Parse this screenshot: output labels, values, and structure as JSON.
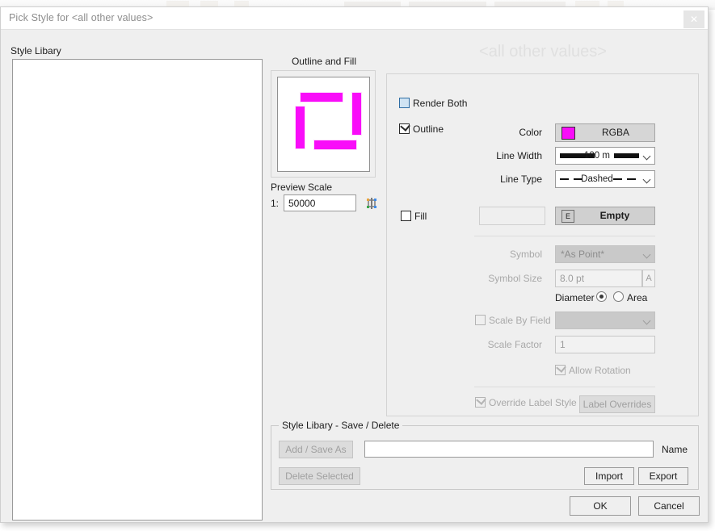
{
  "window": {
    "title": "Pick Style for <all other values>",
    "close_icon": "close-x-icon"
  },
  "library": {
    "label": "Style Libary",
    "items": []
  },
  "preview": {
    "group_label": "Outline and Fill",
    "scale_label": "Preview Scale",
    "scale_prefix": "1:",
    "scale_value": "50000",
    "fit_icon": "fit-to-extent-icon",
    "outline_color": "#f90df9"
  },
  "header": {
    "big_title": "<all other values>"
  },
  "style": {
    "render_both": {
      "label": "Render Both",
      "checked": false
    },
    "outline": {
      "label": "Outline",
      "checked": true,
      "color_label": "Color",
      "color_value": "RGBA",
      "color_hex": "#f90df9",
      "line_width_label": "Line Width",
      "line_width_value": "100 m",
      "line_type_label": "Line Type",
      "line_type_value": "Dashed"
    },
    "fill": {
      "label": "Fill",
      "checked": false,
      "pattern_value": "Empty",
      "pattern_icon_letter": "E"
    },
    "symbol": {
      "label": "Symbol",
      "value": "*As Point*",
      "size_label": "Symbol Size",
      "size_value": "8.0 pt",
      "size_unit_button": "A",
      "diameter_label": "Diameter",
      "diameter_selected": true,
      "area_label": "Area",
      "area_selected": false
    },
    "scaling": {
      "scale_by_field_label": "Scale By Field",
      "scale_by_field_checked": false,
      "scale_by_field_value": "",
      "scale_factor_label": "Scale Factor",
      "scale_factor_value": "1",
      "allow_rotation_label": "Allow Rotation",
      "allow_rotation_checked": true
    },
    "labels": {
      "override_label_style_label": "Override Label Style",
      "override_label_style_checked": true,
      "label_overrides_button": "Label Overrides"
    }
  },
  "save_delete": {
    "group_title": "Style Libary - Save / Delete",
    "add_save_as_button": "Add /  Save As",
    "delete_selected_button": "Delete Selected",
    "name_label": "Name",
    "name_value": "",
    "import_button": "Import",
    "export_button": "Export"
  },
  "footer": {
    "ok_button": "OK",
    "cancel_button": "Cancel"
  }
}
